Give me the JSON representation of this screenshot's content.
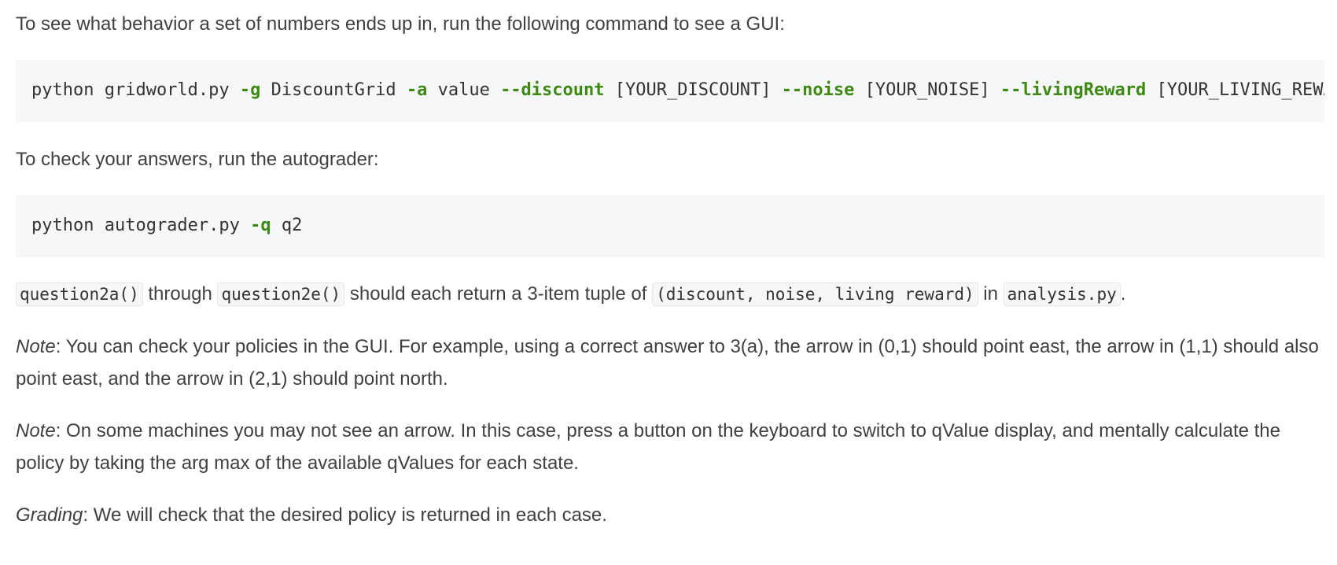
{
  "intro": {
    "text": "To see what behavior a set of numbers ends up in, run the following command to see a GUI:"
  },
  "command1": {
    "prefix": "python gridworld.py ",
    "flag_g": "-g",
    "grid": " DiscountGrid ",
    "flag_a": "-a",
    "agent": " value ",
    "flag_discount": "--discount",
    "discount_val": " [YOUR_DISCOUNT] ",
    "flag_noise": "--noise",
    "noise_val": " [YOUR_NOISE] ",
    "flag_living": "--livingReward",
    "living_val": " [YOUR_LIVING_REWARD]"
  },
  "check": {
    "text": "To check your answers, run the autograder:"
  },
  "command2": {
    "prefix": "python autograder.py ",
    "flag_q": "-q",
    "arg": " q2"
  },
  "tuple_para": {
    "code1": "question2a()",
    "t1": " through ",
    "code2": "question2e()",
    "t2": " should each return a 3-item tuple of ",
    "code3": "(discount, noise, living reward)",
    "t3": " in ",
    "code4": "analysis.py",
    "t4": "."
  },
  "note1": {
    "label": "Note",
    "text": ": You can check your policies in the GUI. For example, using a correct answer to 3(a), the arrow in (0,1) should point east, the arrow in (1,1) should also point east, and the arrow in (2,1) should point north."
  },
  "note2": {
    "label": "Note",
    "text": ": On some machines you may not see an arrow. In this case, press a button on the keyboard to switch to qValue display, and mentally calculate the policy by taking the arg max of the available qValues for each state."
  },
  "grading": {
    "label": "Grading",
    "text": ": We will check that the desired policy is returned in each case."
  }
}
